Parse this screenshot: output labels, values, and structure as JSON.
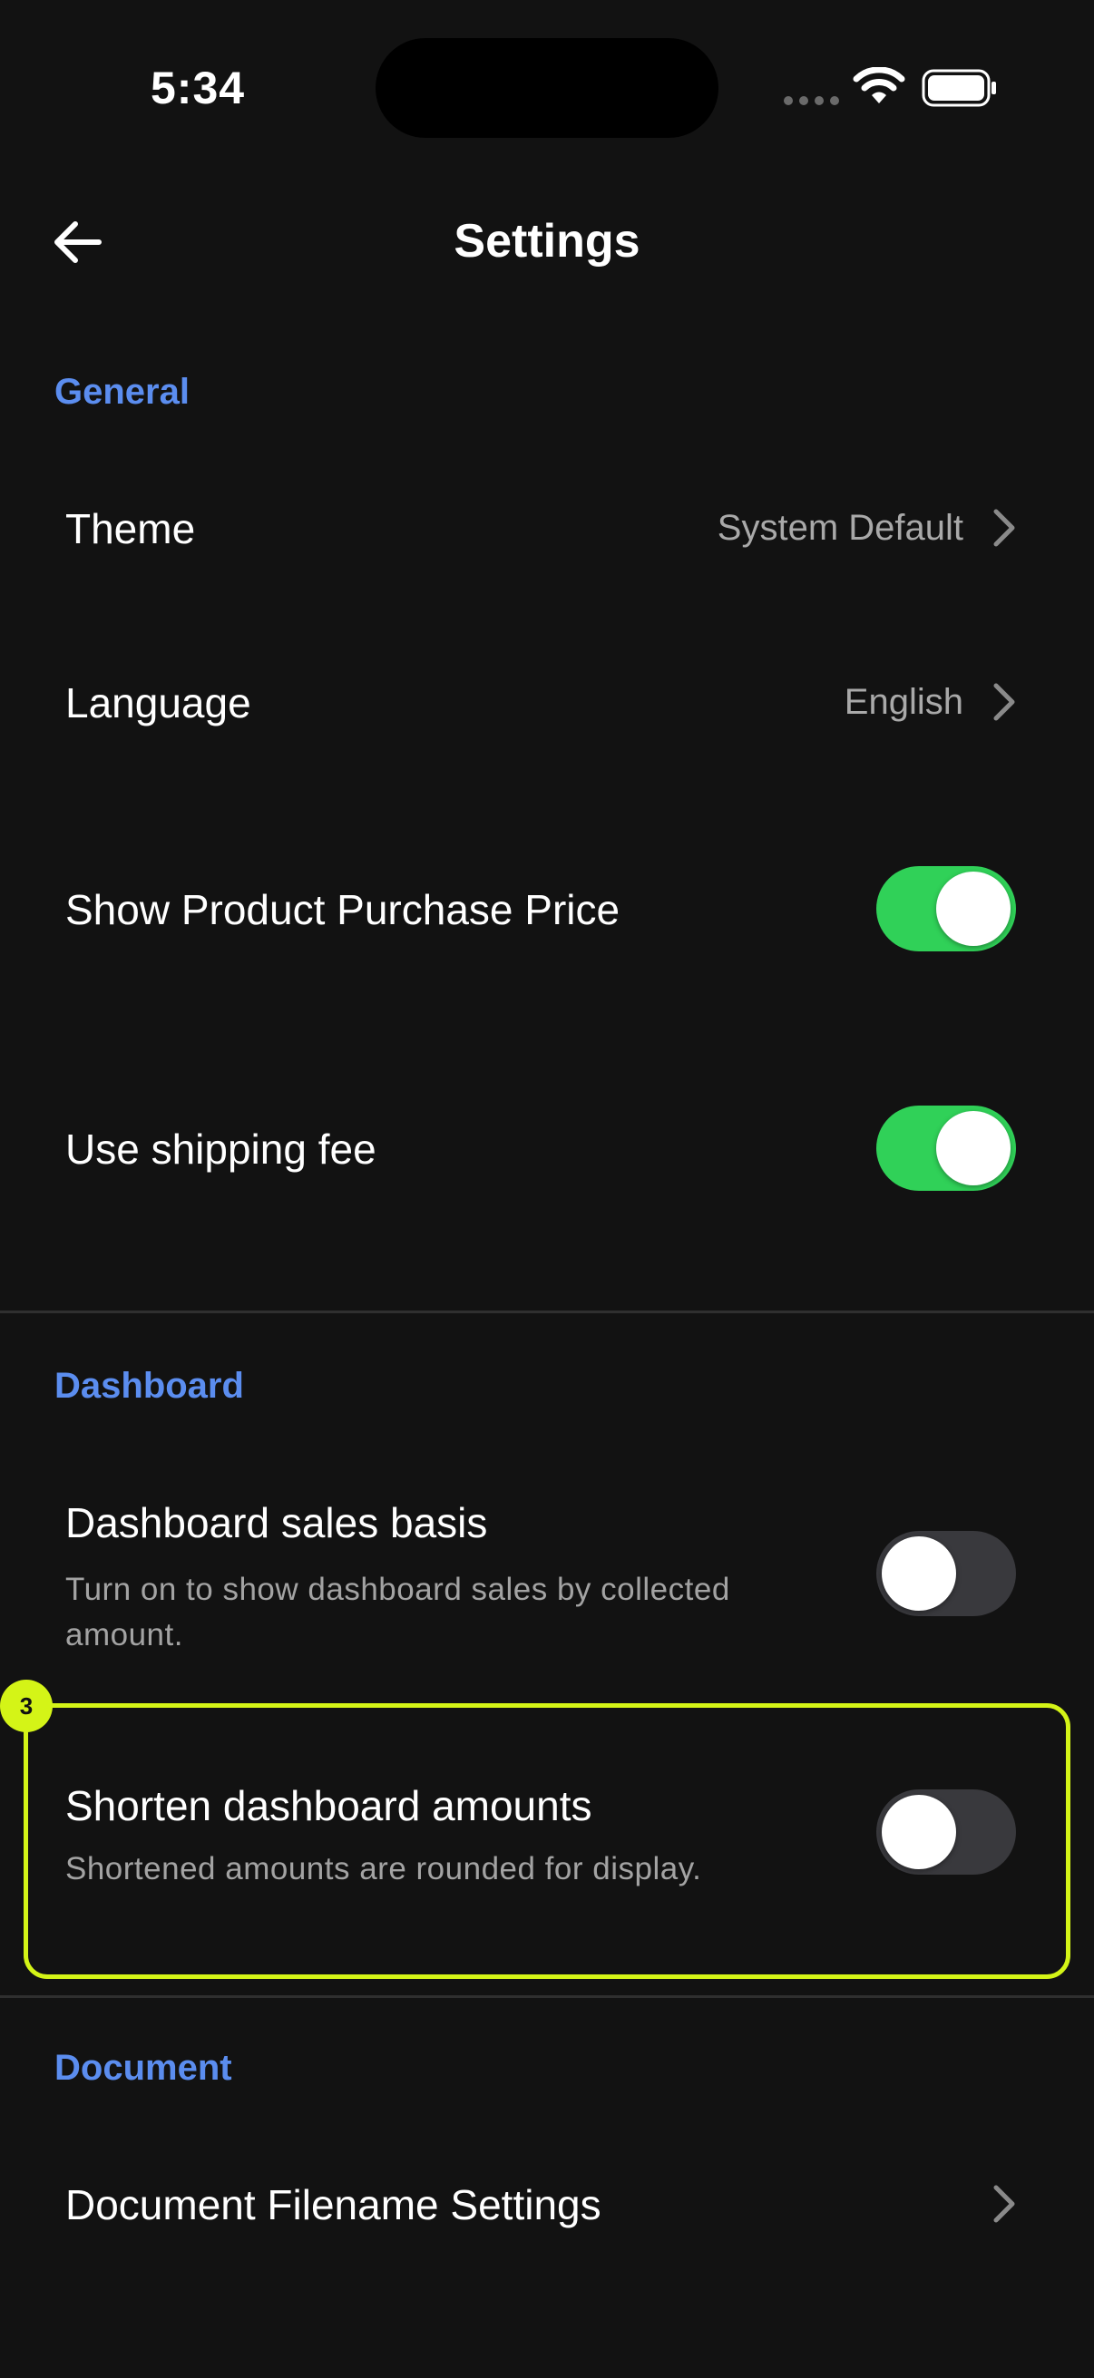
{
  "status_bar": {
    "time": "5:34"
  },
  "header": {
    "title": "Settings",
    "back_icon": "arrow-left-icon"
  },
  "sections": {
    "general": {
      "title": "General",
      "theme": {
        "label": "Theme",
        "value": "System Default"
      },
      "language": {
        "label": "Language",
        "value": "English"
      },
      "show_purchase_price": {
        "label": "Show Product Purchase Price",
        "enabled": true
      },
      "shipping_fee": {
        "label": "Use shipping fee",
        "enabled": true
      }
    },
    "dashboard": {
      "title": "Dashboard",
      "sales_basis": {
        "label": "Dashboard sales basis",
        "description_line1": "Turn on to show dashboard sales by collected",
        "description_line2": "amount.",
        "enabled": false
      },
      "shorten_amounts": {
        "label": "Shorten dashboard amounts",
        "description": "Shortened amounts are rounded for display.",
        "enabled": false
      }
    },
    "document": {
      "title": "Document",
      "filename_settings": {
        "label": "Document Filename Settings"
      }
    }
  },
  "annotation": {
    "badge": "3"
  },
  "colors": {
    "background": "#121212",
    "accent": "#5b8def",
    "toggle_on": "#30d158",
    "toggle_off": "#39393d",
    "highlight": "#d4f417"
  }
}
